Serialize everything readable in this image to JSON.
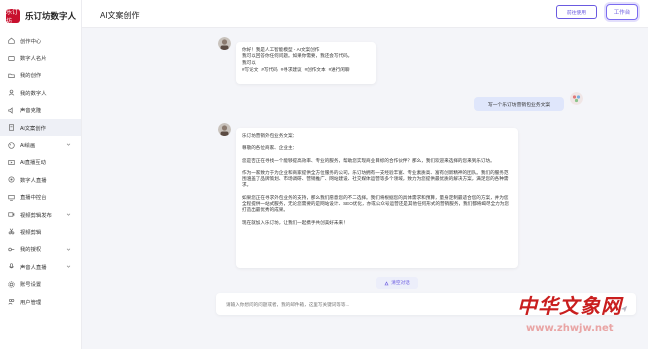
{
  "brand": {
    "name": "乐订坊数字人",
    "logo_text": "乐订坊"
  },
  "header": {
    "title": "AI文案创作",
    "btn_outline": "前往使用",
    "btn_work": "工作台"
  },
  "sidebar": {
    "items": [
      {
        "label": "创作中心",
        "icon": "home-icon"
      },
      {
        "label": "数字人名片",
        "icon": "card-icon"
      },
      {
        "label": "我的创作",
        "icon": "folder-icon"
      },
      {
        "label": "我的数字人",
        "icon": "user-icon"
      },
      {
        "label": "声音克隆",
        "icon": "sound-icon"
      },
      {
        "label": "Ai文案创作",
        "icon": "document-icon",
        "active": true
      },
      {
        "label": "Ai绘画",
        "icon": "paint-icon",
        "caret": true
      },
      {
        "label": "Ai直播互动",
        "icon": "live-icon"
      },
      {
        "label": "数字人直播",
        "icon": "broadcast-icon"
      },
      {
        "label": "直播中控台",
        "icon": "console-icon"
      },
      {
        "label": "视频剪辑发布",
        "icon": "video-icon",
        "caret": true
      },
      {
        "label": "视频剪辑",
        "icon": "scissors-icon"
      },
      {
        "label": "我的授权",
        "icon": "key-icon",
        "caret": true
      },
      {
        "label": "声音人直播",
        "icon": "mic-icon",
        "caret": true
      },
      {
        "label": "账号设置",
        "icon": "gear-icon"
      },
      {
        "label": "用户管理",
        "icon": "users-icon"
      }
    ]
  },
  "chat": {
    "greeting": {
      "lines": [
        "你好！我是人工智能模型 - AI文案创作",
        "我可以回答你任何问题。如果你需要，我还会写代码。",
        "我可以"
      ],
      "topics": [
        "#写论文",
        "#写代码",
        "#寻求建议",
        "#创作文本",
        "#进行闲聊"
      ]
    },
    "user_message": "写一个乐订坊营销包业务文案",
    "reply": {
      "paragraphs": [
        "乐订坊营销外包业务文案：",
        "尊敬的各位商家、企业主：",
        "您是否正在寻找一个能够提高效率、专业的服务，帮助您实现商业目标的合作伙伴？那么，我们欢迎来选择的您来到乐订坊。",
        "作为一家致力于为企业和商家提供全方位服务的公司，乐订坊拥有一支经验丰富、专业素质高、富有创新精神的团队。我们的服务范围涵盖了品牌策划、市场调研、营销推广、网站建设、社交媒体运营等多个领域，致力为您提供最优质的解决方案，满足您的各种需求。",
        "如果您正在寻求外包业务的支持，那么我们愿意您的不二选择。我们将根据您的具体需求和预算，量身定制最适合您的方案，并为您全程提供一站式服务，无论您需要的是网站设计、SEO优化，亦或公众号运营还是其他任何形式的营销服务，我们都将竭尽全力为您打造出最优秀的成果。",
        "现在就加入乐订坊，让我们一起携手共创美好未来！"
      ]
    },
    "clear_label": "清空对话",
    "input_placeholder": "请输入你想问的问题或者，我的邮件箱，这里写关键词等等..."
  },
  "watermark": {
    "title": "中华文象网",
    "url": "www.zhwjw.net"
  },
  "colors": {
    "accent": "#6a5ae0",
    "user_bubble": "#dfe6fb",
    "brand_red": "#c8102e",
    "background": "#f4f5f9"
  }
}
